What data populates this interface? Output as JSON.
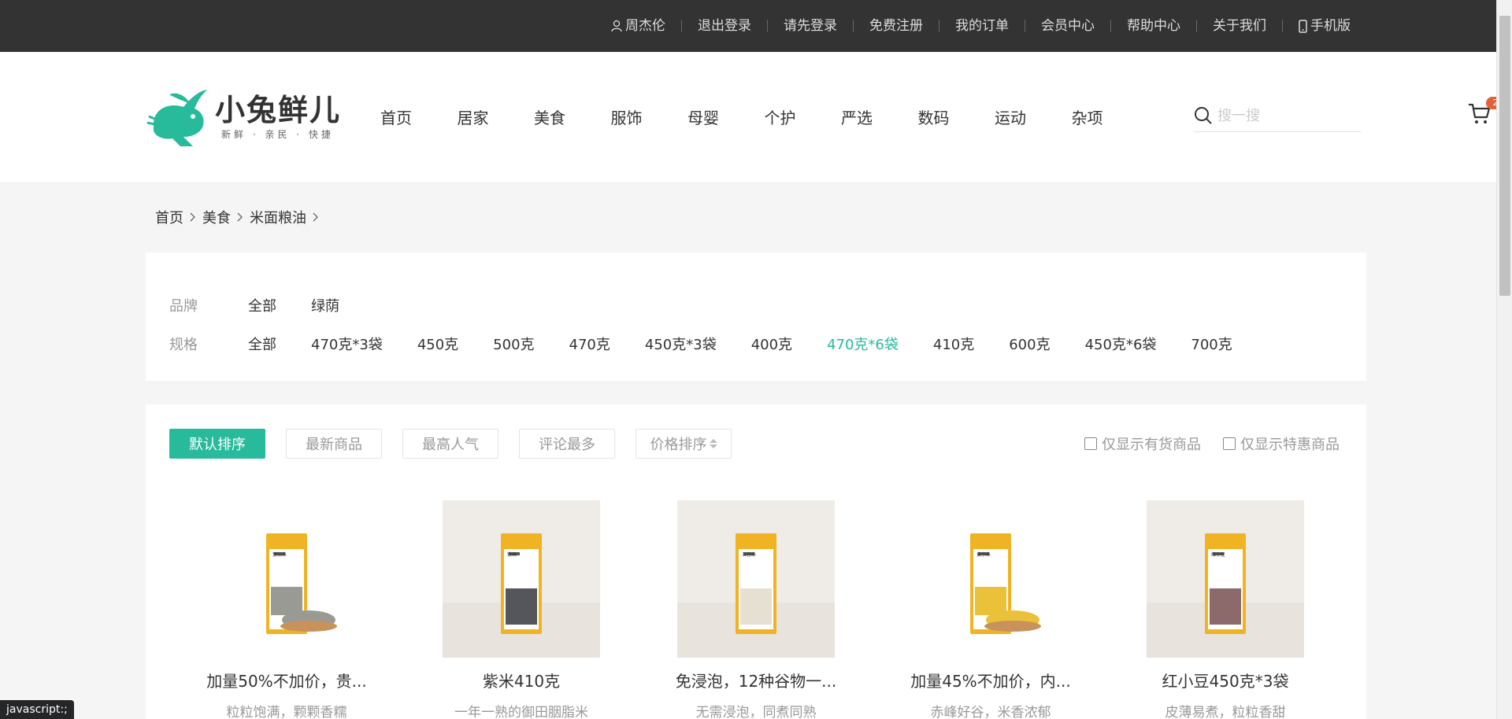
{
  "topbar": {
    "items": [
      {
        "label": "周杰伦",
        "icon": "user-icon"
      },
      {
        "label": "退出登录"
      },
      {
        "label": "请先登录"
      },
      {
        "label": "免费注册"
      },
      {
        "label": "我的订单"
      },
      {
        "label": "会员中心"
      },
      {
        "label": "帮助中心"
      },
      {
        "label": "关于我们"
      },
      {
        "label": "手机版",
        "icon": "phone-icon"
      }
    ]
  },
  "header": {
    "logo_title": "小兔鲜儿",
    "logo_slogan": "新鲜 · 亲民 · 快捷",
    "nav": [
      "首页",
      "居家",
      "美食",
      "服饰",
      "母婴",
      "个护",
      "严选",
      "数码",
      "运动",
      "杂项"
    ],
    "search_placeholder": "搜一搜",
    "cart_count": "2"
  },
  "breadcrumb": [
    "首页",
    "美食",
    "米面粮油"
  ],
  "filters": {
    "brand": {
      "label": "品牌",
      "options": [
        "全部",
        "绿荫"
      ]
    },
    "spec": {
      "label": "规格",
      "options": [
        "全部",
        "470克*3袋",
        "450克",
        "500克",
        "470克",
        "450克*3袋",
        "400克",
        "470克*6袋",
        "410克",
        "600克",
        "450克*6袋",
        "700克"
      ],
      "active": "470克*6袋"
    }
  },
  "sort": {
    "buttons": [
      "默认排序",
      "最新商品",
      "最高人气",
      "评论最多",
      "价格排序"
    ],
    "active": "默认排序",
    "checks": [
      "仅显示有货商品",
      "仅显示特惠商品"
    ]
  },
  "products": [
    {
      "name": "加量50%不加价，贵...",
      "desc": "粒粒饱满，颗颗香糯",
      "bag_label": "薏仁米"
    },
    {
      "name": "紫米410克",
      "desc": "一年一熟的御田胭脂米",
      "bag_label": "紫米"
    },
    {
      "name": "免浸泡，12种谷物一...",
      "desc": "无需浸泡，同煮同熟",
      "bag_label": "五谷米"
    },
    {
      "name": "加量45%不加价，内...",
      "desc": "赤峰好谷，米香浓郁",
      "bag_label": "黄小米"
    },
    {
      "name": "红小豆450克*3袋",
      "desc": "皮薄易煮，粒粒香甜",
      "bag_label": "红小豆"
    }
  ],
  "status_text": "javascript:;",
  "colors": {
    "accent": "#27ba9b",
    "topbar": "#333333",
    "badge": "#e26237"
  }
}
